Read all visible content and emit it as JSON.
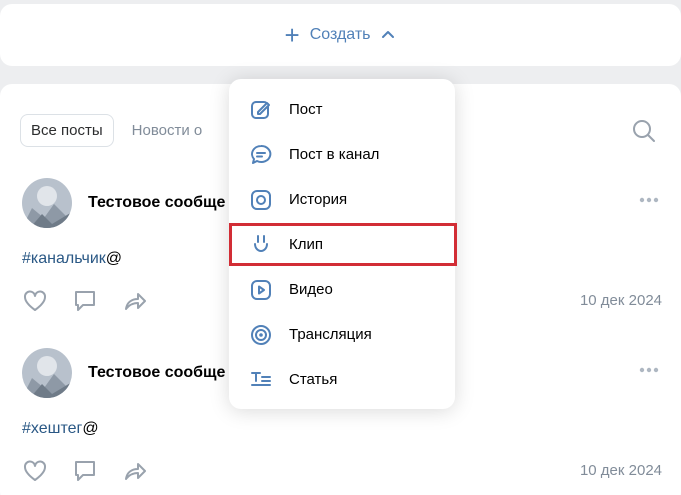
{
  "create_bar": {
    "label": "Создать",
    "plus": "+"
  },
  "tabs": {
    "active": "Все посты",
    "other": "Новости о"
  },
  "posts": [
    {
      "title": "Тестовое сообще",
      "hashtag": "#канальчик",
      "suffix": "@",
      "date": "10 дек 2024"
    },
    {
      "title": "Тестовое сообще",
      "hashtag": "#хештег",
      "suffix": "@",
      "date": "10 дек 2024"
    }
  ],
  "menu": {
    "items": [
      {
        "label": "Пост",
        "icon": "edit-icon"
      },
      {
        "label": "Пост в канал",
        "icon": "message-icon"
      },
      {
        "label": "История",
        "icon": "story-icon"
      },
      {
        "label": "Клип",
        "icon": "clip-icon"
      },
      {
        "label": "Видео",
        "icon": "video-icon"
      },
      {
        "label": "Трансляция",
        "icon": "broadcast-icon"
      },
      {
        "label": "Статья",
        "icon": "article-icon"
      }
    ],
    "highlighted": "Клип"
  },
  "colors": {
    "accent": "#5181b8",
    "link": "#2a5885",
    "muted": "#818c99",
    "highlight": "#d22d35"
  }
}
